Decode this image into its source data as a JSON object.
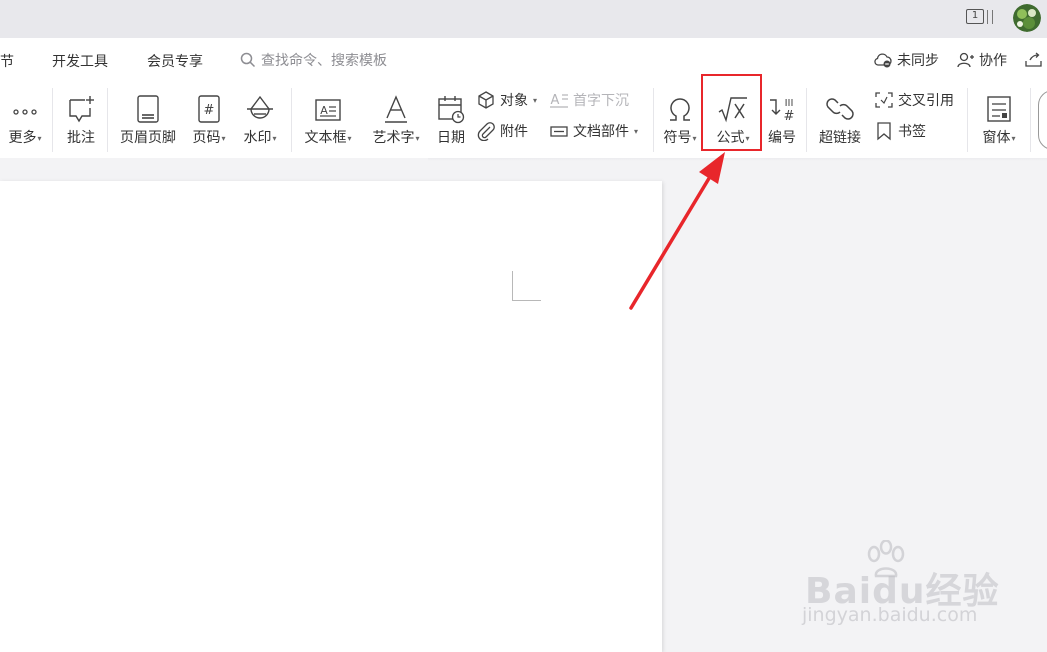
{
  "window": {
    "page_badge": "1"
  },
  "menu": {
    "items": [
      "章节",
      "开发工具",
      "会员专享"
    ],
    "search_placeholder": "查找命令、搜索模板",
    "sync_label": "未同步",
    "collab_label": "协作"
  },
  "toolbar": {
    "more": "更多",
    "comment": "批注",
    "header_footer": "页眉页脚",
    "page_number": "页码",
    "watermark": "水印",
    "textbox": "文本框",
    "wordart": "艺术字",
    "date": "日期",
    "object": "对象",
    "attachment": "附件",
    "drop_cap": "首字下沉",
    "doc_parts": "文档部件",
    "symbol": "符号",
    "formula": "公式",
    "numbering": "编号",
    "hyperlink": "超链接",
    "cross_reference": "交叉引用",
    "bookmark": "书签",
    "form": "窗体"
  },
  "watermark": {
    "logo": "Baidu经验",
    "url": "jingyan.baidu.com"
  },
  "colors": {
    "highlight": "#e8262b",
    "arrow": "#e8262b",
    "toolbar_bg": "#ffffff",
    "canvas_bg": "#f3f3f5"
  }
}
